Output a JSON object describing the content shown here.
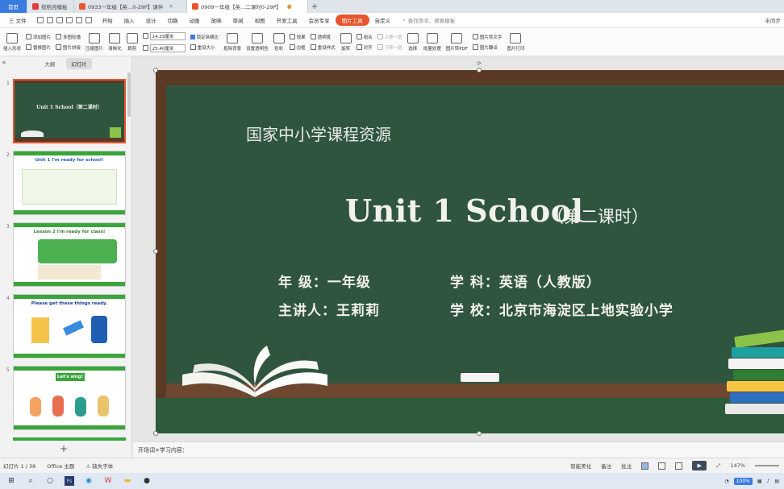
{
  "tabs": [
    {
      "label": "首页",
      "kind": "home"
    },
    {
      "label": "找稻壳模板",
      "icon_color": "#e03a3a"
    },
    {
      "label": "0933一年级【英...0-29P】课件",
      "icon_color": "#e8552e"
    },
    {
      "label": "0909一年级【英...二课时0-29P】",
      "icon_color": "#e8552e",
      "active": true
    }
  ],
  "menu": {
    "file": "三 文件",
    "items": [
      "开始",
      "插入",
      "设计",
      "切换",
      "动画",
      "放映",
      "审阅",
      "视图",
      "开发工具",
      "会员专享"
    ],
    "picture_tools": "图片工具",
    "custom": "自定义",
    "search_placeholder": "查找命令、搜索模板",
    "right": "未同步"
  },
  "ribbon": {
    "insert_shape": "插入形状",
    "add_picture": "添加图片",
    "replace_picture": "替换图片",
    "multi_combine": "多图轮播",
    "picture_splice": "图片拼接",
    "compress": "压缩图片",
    "sharpen": "清晰化",
    "crop": "裁剪",
    "height_value": "14.29厘米",
    "width_value": "25.40厘米",
    "lock_ratio": "锁定纵横比",
    "reset_size": "重设大小",
    "remove_bg": "抠除背景",
    "set_transparent": "设置透明色",
    "color": "色彩",
    "effects": "效果",
    "border": "边框",
    "transparency": "透明度",
    "reset_style": "重设样式",
    "rotate": "旋转",
    "combine": "组合",
    "align": "对齐",
    "bring_forward": "上移一层",
    "send_backward": "下移一层",
    "select": "选择",
    "batch": "批量处理",
    "to_pdf": "图片转PDF",
    "to_text": "图片转文字",
    "translate": "图片翻译",
    "print": "图片打印"
  },
  "left_pane": {
    "outline_tab": "大纲",
    "slides_tab": "幻灯片",
    "thumbs": [
      {
        "num": "1",
        "title": "Unit 1 School（第二课时）"
      },
      {
        "num": "2",
        "title": "Unit 1 I'm ready for school!"
      },
      {
        "num": "3",
        "title": "Lesson 2  I'm ready for class!"
      },
      {
        "num": "4",
        "title": "Please get these things ready."
      },
      {
        "num": "5",
        "title": "Let's sing!"
      }
    ],
    "add": "+"
  },
  "slide": {
    "subtitle": "国家中小学课程资源",
    "title": "Unit 1 School",
    "title_suffix": "（第二课时）",
    "grade_line": "年  级：一年级",
    "subject_line": "学  科：英语（人教版）",
    "teacher_line": "主讲人：王莉莉",
    "school_line": "学  校：北京市海淀区上地实验小学"
  },
  "notes_placeholder": "开场词+学习内容：",
  "status": {
    "slide_count": "幻灯片 1 / 38",
    "theme": "Office 主题",
    "missing_font": "缺失字体",
    "smart_beautify": "智能美化",
    "notes": "备注",
    "comments": "批注",
    "zoom": "147%"
  },
  "taskbar": {
    "battery": "100%"
  },
  "colors": {
    "accent": "#e8552e",
    "chalkboard": "#30553f",
    "frame": "#5b3a25"
  }
}
